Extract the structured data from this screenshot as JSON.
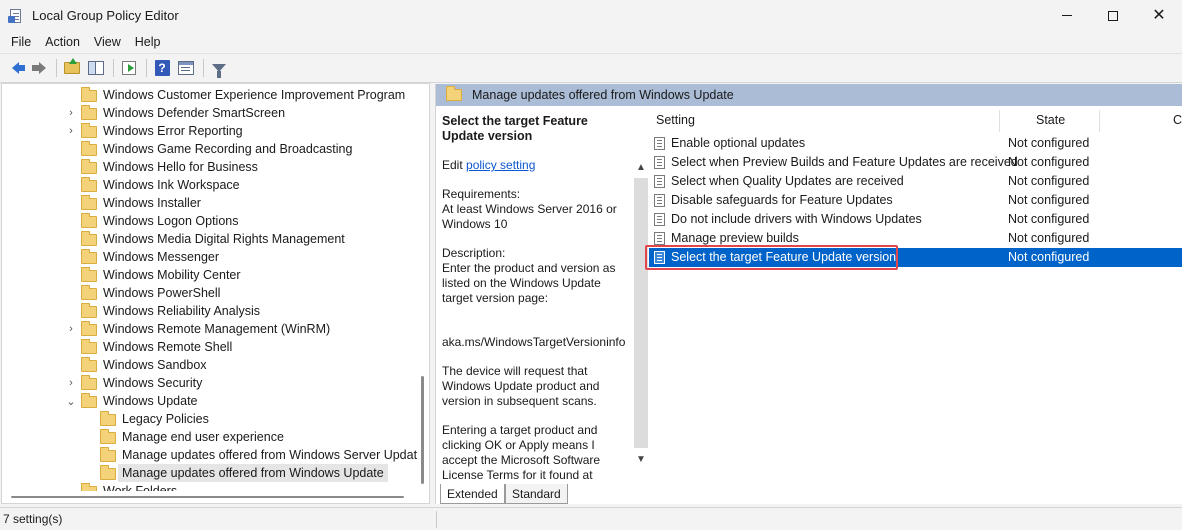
{
  "window": {
    "title": "Local Group Policy Editor",
    "controls": {
      "minimize": "",
      "maximize": "",
      "close": "✕"
    }
  },
  "menu": [
    "File",
    "Action",
    "View",
    "Help"
  ],
  "toolbar": {
    "icons": [
      "back-arrow-icon",
      "forward-arrow-icon",
      "up-folder-icon",
      "show-hide-tree-icon",
      "export-list-icon",
      "help-icon",
      "properties-icon",
      "filter-icon"
    ],
    "help_glyph": "?"
  },
  "tree": {
    "items": [
      {
        "label": "Windows Customer Experience Improvement Program",
        "level": 1,
        "expander": false,
        "selected": false
      },
      {
        "label": "Windows Defender SmartScreen",
        "level": 1,
        "expander": true,
        "expanded": false,
        "selected": false
      },
      {
        "label": "Windows Error Reporting",
        "level": 1,
        "expander": true,
        "expanded": false,
        "selected": false
      },
      {
        "label": "Windows Game Recording and Broadcasting",
        "level": 1,
        "expander": false,
        "selected": false
      },
      {
        "label": "Windows Hello for Business",
        "level": 1,
        "expander": false,
        "selected": false
      },
      {
        "label": "Windows Ink Workspace",
        "level": 1,
        "expander": false,
        "selected": false
      },
      {
        "label": "Windows Installer",
        "level": 1,
        "expander": false,
        "selected": false
      },
      {
        "label": "Windows Logon Options",
        "level": 1,
        "expander": false,
        "selected": false
      },
      {
        "label": "Windows Media Digital Rights Management",
        "level": 1,
        "expander": false,
        "selected": false
      },
      {
        "label": "Windows Messenger",
        "level": 1,
        "expander": false,
        "selected": false
      },
      {
        "label": "Windows Mobility Center",
        "level": 1,
        "expander": false,
        "selected": false
      },
      {
        "label": "Windows PowerShell",
        "level": 1,
        "expander": false,
        "selected": false
      },
      {
        "label": "Windows Reliability Analysis",
        "level": 1,
        "expander": false,
        "selected": false
      },
      {
        "label": "Windows Remote Management (WinRM)",
        "level": 1,
        "expander": true,
        "expanded": false,
        "selected": false
      },
      {
        "label": "Windows Remote Shell",
        "level": 1,
        "expander": false,
        "selected": false
      },
      {
        "label": "Windows Sandbox",
        "level": 1,
        "expander": false,
        "selected": false
      },
      {
        "label": "Windows Security",
        "level": 1,
        "expander": true,
        "expanded": false,
        "selected": false
      },
      {
        "label": "Windows Update",
        "level": 1,
        "expander": true,
        "expanded": true,
        "selected": false
      },
      {
        "label": "Legacy Policies",
        "level": 2,
        "expander": false,
        "selected": false
      },
      {
        "label": "Manage end user experience",
        "level": 2,
        "expander": false,
        "selected": false
      },
      {
        "label": "Manage updates offered from Windows Server Update S",
        "level": 2,
        "expander": false,
        "selected": false
      },
      {
        "label": "Manage updates offered from Windows Update",
        "level": 2,
        "expander": false,
        "selected": true
      },
      {
        "label": "Work Folders",
        "level": 1,
        "expander": false,
        "selected": false
      }
    ],
    "chevron_collapsed": "›",
    "chevron_expanded": "⌄"
  },
  "right": {
    "header": "Manage updates offered from Windows Update",
    "description": {
      "title": "Select the target Feature Update version",
      "edit_prefix": "Edit ",
      "edit_link": "policy setting",
      "requirements": "Requirements:\nAt least Windows Server 2016 or Windows 10",
      "description": "Description:\nEnter the product and version as listed on the Windows Update target version page:",
      "link_text": "aka.ms/WindowsTargetVersioninfo",
      "para2": "The device will request that Windows Update product and version in subsequent scans.",
      "para3": "Entering a target product and clicking OK or Apply means I accept the Microsoft Software License Terms for it found at"
    },
    "scroll": {
      "up": "▲",
      "down": "▼"
    },
    "columns": {
      "setting": "Setting",
      "state": "State",
      "comment": "C"
    },
    "settings": [
      {
        "name": "Enable optional updates",
        "state": "Not configured",
        "selected": false
      },
      {
        "name": "Select when Preview Builds and Feature Updates are received",
        "state": "Not configured",
        "selected": false
      },
      {
        "name": "Select when Quality Updates are received",
        "state": "Not configured",
        "selected": false
      },
      {
        "name": "Disable safeguards for Feature Updates",
        "state": "Not configured",
        "selected": false
      },
      {
        "name": "Do not include drivers with Windows Updates",
        "state": "Not configured",
        "selected": false
      },
      {
        "name": "Manage preview builds",
        "state": "Not configured",
        "selected": false
      },
      {
        "name": "Select the target Feature Update version",
        "state": "Not configured",
        "selected": true
      }
    ],
    "tabs": [
      "Extended",
      "Standard"
    ],
    "active_tab": "Extended"
  },
  "status": {
    "text": "7 setting(s)"
  }
}
